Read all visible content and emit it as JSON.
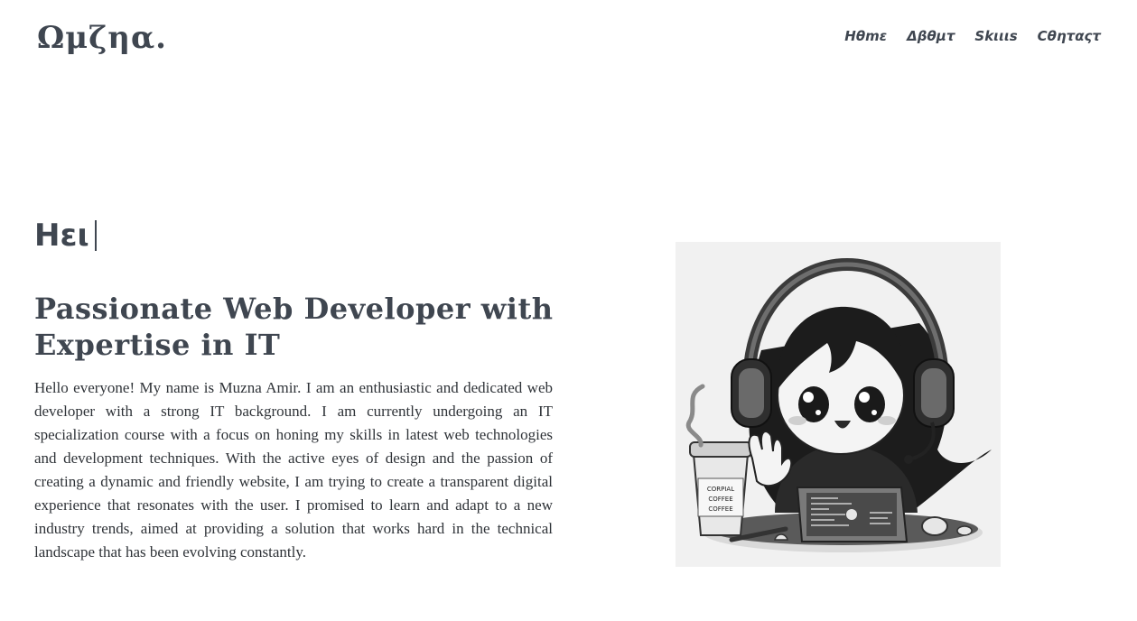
{
  "header": {
    "logo": "Ωμζηα.",
    "nav": [
      {
        "label": "Ηθmε"
      },
      {
        "label": "Δβθμτ"
      },
      {
        "label": "Skιιιs"
      },
      {
        "label": "Cθηταςτ"
      }
    ]
  },
  "hero": {
    "greeting": "Ηει",
    "headline": "Passionate Web Developer with Expertise in IT",
    "about": "Hello everyone! My name is Muzna Amir. I am an enthusiastic and dedicated web developer with a strong IT background. I am currently undergoing an IT specialization course with a focus on honing my skills in latest web technologies and development techniques. With the active eyes of design and the passion of creating a dynamic and friendly website, I am trying to create a transparent digital experience that resonates with the user. I promised to learn and adapt to a new industry trends, aimed at providing a solution that works hard in the technical landscape that has been evolving constantly.",
    "illustration": {
      "cup_text": [
        "CORPIAL",
        "COFFEE",
        "COFFEE"
      ]
    }
  },
  "colors": {
    "text": "#3f4650",
    "background": "#ffffff",
    "illustration_bg": "#f1f1f1"
  }
}
